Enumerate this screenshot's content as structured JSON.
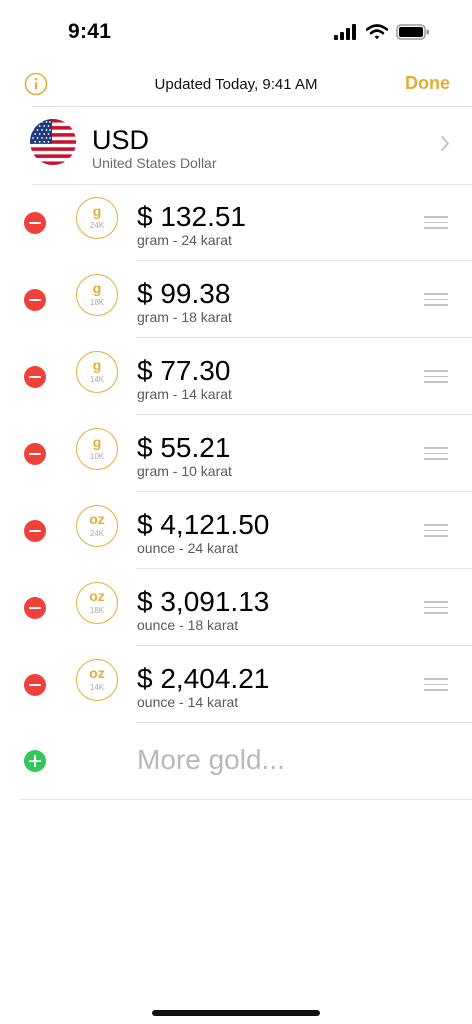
{
  "status_bar": {
    "time": "9:41"
  },
  "nav": {
    "title": "Updated Today, 9:41 AM",
    "done_label": "Done"
  },
  "currency": {
    "code": "USD",
    "name": "United States Dollar"
  },
  "items": [
    {
      "unit_symbol": "g",
      "karat": "24K",
      "price": "$ 132.51",
      "unit_label": "gram - 24 karat"
    },
    {
      "unit_symbol": "g",
      "karat": "18K",
      "price": "$ 99.38",
      "unit_label": "gram - 18 karat"
    },
    {
      "unit_symbol": "g",
      "karat": "14K",
      "price": "$ 77.30",
      "unit_label": "gram - 14 karat"
    },
    {
      "unit_symbol": "g",
      "karat": "10K",
      "price": "$ 55.21",
      "unit_label": "gram - 10 karat"
    },
    {
      "unit_symbol": "oz",
      "karat": "24K",
      "price": "$ 4,121.50",
      "unit_label": "ounce - 24 karat"
    },
    {
      "unit_symbol": "oz",
      "karat": "18K",
      "price": "$ 3,091.13",
      "unit_label": "ounce - 18 karat"
    },
    {
      "unit_symbol": "oz",
      "karat": "14K",
      "price": "$ 2,404.21",
      "unit_label": "ounce - 14 karat"
    }
  ],
  "add_more": {
    "label": "More gold..."
  },
  "colors": {
    "accent": "#E4AE36",
    "delete": "#F0403A",
    "add": "#34C759"
  }
}
